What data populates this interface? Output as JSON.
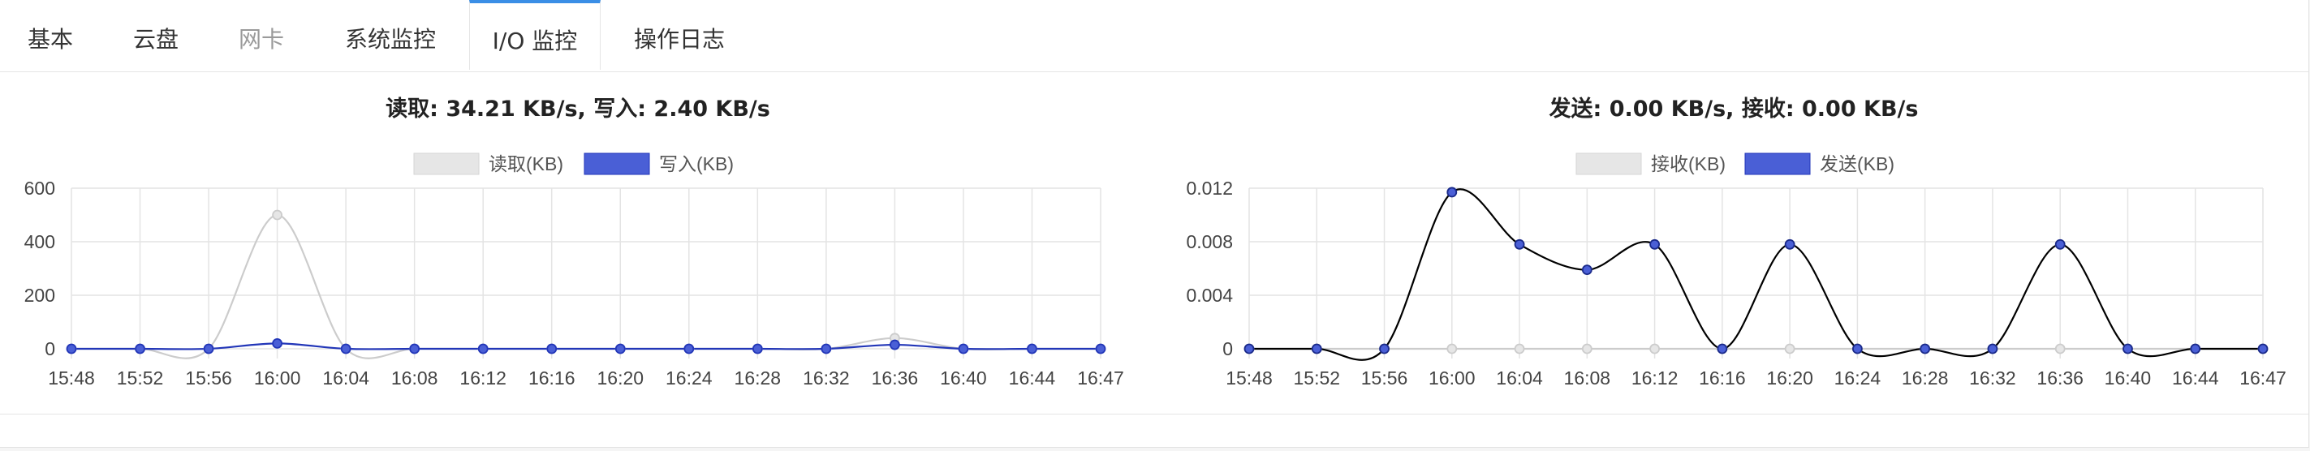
{
  "tabs": [
    {
      "label": "基本",
      "state": "normal"
    },
    {
      "label": "云盘",
      "state": "normal"
    },
    {
      "label": "网卡",
      "state": "disabled"
    },
    {
      "label": "系统监控",
      "state": "normal"
    },
    {
      "label": "I/O 监控",
      "state": "active"
    },
    {
      "label": "操作日志",
      "state": "normal"
    }
  ],
  "colors": {
    "accent": "#3a8ee6",
    "series_light_fill": "#e6e6e6",
    "series_light_stroke": "#cccccc",
    "series_blue_fill": "#4a5fd6",
    "series_blue_stroke": "#2236b8",
    "series_black_stroke": "#000000",
    "grid": "#e4e4e4"
  },
  "chart_data": [
    {
      "type": "line",
      "title": "读取: 34.21 KB/s, 写入: 2.40 KB/s",
      "categories": [
        "15:48",
        "15:52",
        "15:56",
        "16:00",
        "16:04",
        "16:08",
        "16:12",
        "16:16",
        "16:20",
        "16:24",
        "16:28",
        "16:32",
        "16:36",
        "16:40",
        "16:44",
        "16:47"
      ],
      "series": [
        {
          "name": "读取(KB)",
          "style": "light",
          "values": [
            0,
            0,
            0,
            500,
            0,
            0,
            0,
            0,
            0,
            0,
            0,
            0,
            40,
            0,
            0,
            0
          ]
        },
        {
          "name": "写入(KB)",
          "style": "blue",
          "values": [
            0,
            0,
            0,
            20,
            0,
            0,
            0,
            0,
            0,
            0,
            0,
            0,
            15,
            0,
            0,
            0
          ]
        }
      ],
      "yticks": [
        "600",
        "400",
        "200",
        "0"
      ],
      "ylim": [
        0,
        600
      ],
      "grid": true,
      "legend": "top-center"
    },
    {
      "type": "line",
      "title": "发送: 0.00 KB/s, 接收: 0.00 KB/s",
      "categories": [
        "15:48",
        "15:52",
        "15:56",
        "16:00",
        "16:04",
        "16:08",
        "16:12",
        "16:16",
        "16:20",
        "16:24",
        "16:28",
        "16:32",
        "16:36",
        "16:40",
        "16:44",
        "16:47"
      ],
      "series": [
        {
          "name": "接收(KB)",
          "style": "light",
          "values": [
            0,
            0,
            0,
            0,
            0,
            0,
            0,
            0,
            0,
            0,
            0,
            0,
            0,
            0,
            0,
            0
          ]
        },
        {
          "name": "发送(KB)",
          "style": "blue-black",
          "values": [
            0,
            0,
            0,
            0.0117,
            0.0078,
            0.0059,
            0.0078,
            0,
            0.0078,
            0,
            0,
            0,
            0.0078,
            0,
            0,
            0
          ]
        }
      ],
      "yticks": [
        "0.012",
        "0.008",
        "0.004",
        "0"
      ],
      "ylim": [
        0,
        0.012
      ],
      "grid": true,
      "legend": "top-center"
    }
  ]
}
